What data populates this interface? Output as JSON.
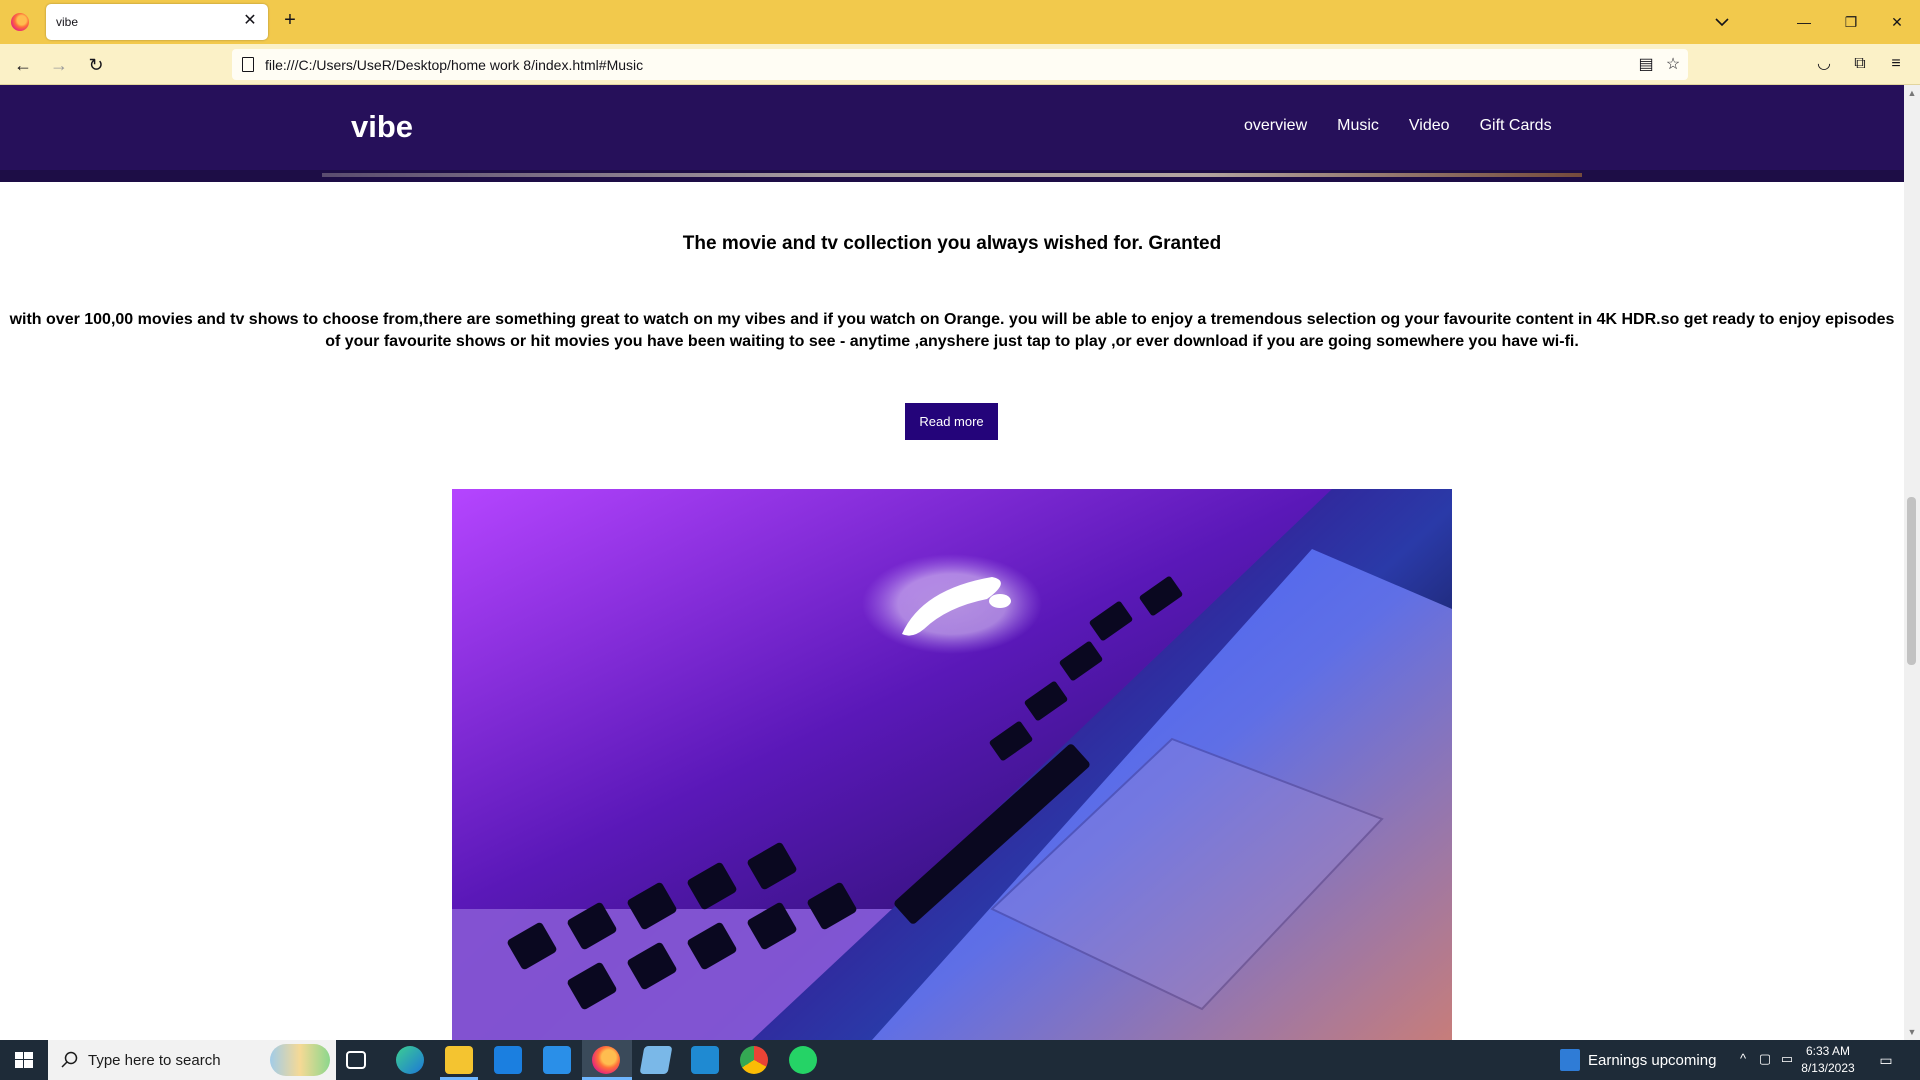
{
  "browser": {
    "tab_title": "vibe",
    "url": "file:///C:/Users/UseR/Desktop/home work 8/index.html#Music"
  },
  "site": {
    "brand": "vibe",
    "nav": [
      "overview",
      "Music",
      "Video",
      "Gift Cards"
    ],
    "headline": "The movie and tv collection you always wished for. Granted",
    "description": "with over 100,00 movies and tv shows to choose from,there are something great to watch on my vibes and if you watch on Orange. you will be able to enjoy a tremendous selection og your favourite content in 4K HDR.so get ready to enjoy episodes of your favourite shows or hit movies you have been waiting to see - anytime ,anyshere just tap to play ,or ever download if you are going somewhere you have wi-fi.",
    "read_more": "Read more",
    "colors": {
      "header_bg": "#26105a",
      "button_bg": "#24047a"
    }
  },
  "taskbar": {
    "search_placeholder": "Type here to search",
    "weather_text": "Earnings upcoming",
    "time": "6:33 AM",
    "date": "8/13/2023",
    "apps": [
      "task-view",
      "edge",
      "file-explorer",
      "microsoft-store",
      "mail",
      "firefox",
      "notepad",
      "vscode",
      "chrome",
      "whatsapp"
    ]
  }
}
